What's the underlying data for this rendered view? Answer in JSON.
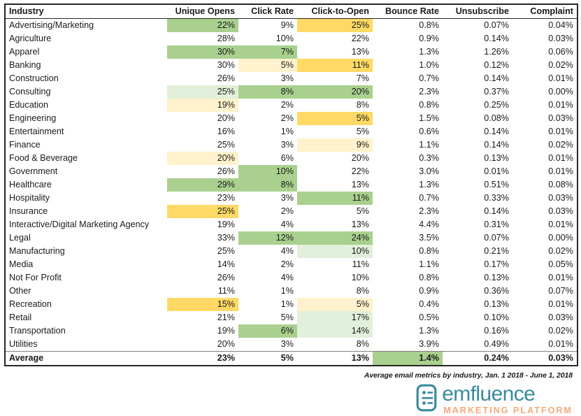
{
  "table": {
    "columns": [
      {
        "key": "industry",
        "label": "Industry",
        "align": "left"
      },
      {
        "key": "unique_opens",
        "label": "Unique Opens",
        "align": "right"
      },
      {
        "key": "click_rate",
        "label": "Click Rate",
        "align": "right"
      },
      {
        "key": "click_to_open",
        "label": "Click-to-Open",
        "align": "right"
      },
      {
        "key": "bounce_rate",
        "label": "Bounce Rate",
        "align": "right"
      },
      {
        "key": "unsubscribe",
        "label": "Unsubscribe",
        "align": "right"
      },
      {
        "key": "complaint",
        "label": "Complaint",
        "align": "right"
      }
    ],
    "rows": [
      {
        "industry": "Advertising/Marketing",
        "unique_opens": "22%",
        "click_rate": "9%",
        "click_to_open": "25%",
        "bounce_rate": "0.8%",
        "unsubscribe": "0.07%",
        "complaint": "0.04%",
        "fills": {
          "unique_opens": "green",
          "click_to_open": "yellow"
        }
      },
      {
        "industry": "Agriculture",
        "unique_opens": "28%",
        "click_rate": "10%",
        "click_to_open": "22%",
        "bounce_rate": "0.9%",
        "unsubscribe": "0.14%",
        "complaint": "0.03%",
        "fills": {}
      },
      {
        "industry": "Apparel",
        "unique_opens": "30%",
        "click_rate": "7%",
        "click_to_open": "13%",
        "bounce_rate": "1.3%",
        "unsubscribe": "1.26%",
        "complaint": "0.06%",
        "fills": {
          "unique_opens": "green",
          "click_rate": "green"
        }
      },
      {
        "industry": "Banking",
        "unique_opens": "30%",
        "click_rate": "5%",
        "click_to_open": "11%",
        "bounce_rate": "1.0%",
        "unsubscribe": "0.12%",
        "complaint": "0.02%",
        "fills": {
          "click_rate": "lyellow",
          "click_to_open": "yellow"
        }
      },
      {
        "industry": "Construction",
        "unique_opens": "26%",
        "click_rate": "3%",
        "click_to_open": "7%",
        "bounce_rate": "0.7%",
        "unsubscribe": "0.14%",
        "complaint": "0.01%",
        "fills": {}
      },
      {
        "industry": "Consulting",
        "unique_opens": "25%",
        "click_rate": "8%",
        "click_to_open": "20%",
        "bounce_rate": "2.3%",
        "unsubscribe": "0.37%",
        "complaint": "0.00%",
        "fills": {
          "unique_opens": "lgreen",
          "click_rate": "green",
          "click_to_open": "green"
        }
      },
      {
        "industry": "Education",
        "unique_opens": "19%",
        "click_rate": "2%",
        "click_to_open": "8%",
        "bounce_rate": "0.8%",
        "unsubscribe": "0.25%",
        "complaint": "0.01%",
        "fills": {
          "unique_opens": "lyellow"
        }
      },
      {
        "industry": "Engineering",
        "unique_opens": "20%",
        "click_rate": "2%",
        "click_to_open": "5%",
        "bounce_rate": "1.5%",
        "unsubscribe": "0.08%",
        "complaint": "0.03%",
        "fills": {
          "click_to_open": "yellow"
        }
      },
      {
        "industry": "Entertainment",
        "unique_opens": "16%",
        "click_rate": "1%",
        "click_to_open": "5%",
        "bounce_rate": "0.6%",
        "unsubscribe": "0.14%",
        "complaint": "0.01%",
        "fills": {}
      },
      {
        "industry": "Finance",
        "unique_opens": "25%",
        "click_rate": "3%",
        "click_to_open": "9%",
        "bounce_rate": "1.1%",
        "unsubscribe": "0.14%",
        "complaint": "0.02%",
        "fills": {
          "click_to_open": "lyellow"
        }
      },
      {
        "industry": "Food & Beverage",
        "unique_opens": "20%",
        "click_rate": "6%",
        "click_to_open": "20%",
        "bounce_rate": "0.3%",
        "unsubscribe": "0.13%",
        "complaint": "0.01%",
        "fills": {
          "unique_opens": "lyellow"
        }
      },
      {
        "industry": "Government",
        "unique_opens": "26%",
        "click_rate": "10%",
        "click_to_open": "22%",
        "bounce_rate": "3.0%",
        "unsubscribe": "0.01%",
        "complaint": "0.01%",
        "fills": {
          "click_rate": "green"
        }
      },
      {
        "industry": "Healthcare",
        "unique_opens": "29%",
        "click_rate": "8%",
        "click_to_open": "13%",
        "bounce_rate": "1.3%",
        "unsubscribe": "0.51%",
        "complaint": "0.08%",
        "fills": {
          "unique_opens": "green",
          "click_rate": "green"
        }
      },
      {
        "industry": "Hospitality",
        "unique_opens": "23%",
        "click_rate": "3%",
        "click_to_open": "11%",
        "bounce_rate": "0.7%",
        "unsubscribe": "0.33%",
        "complaint": "0.03%",
        "fills": {
          "click_to_open": "green"
        }
      },
      {
        "industry": "Insurance",
        "unique_opens": "25%",
        "click_rate": "2%",
        "click_to_open": "5%",
        "bounce_rate": "2.3%",
        "unsubscribe": "0.14%",
        "complaint": "0.03%",
        "fills": {
          "unique_opens": "yellow"
        }
      },
      {
        "industry": "Interactive/Digital Marketing Agency",
        "unique_opens": "19%",
        "click_rate": "4%",
        "click_to_open": "13%",
        "bounce_rate": "4.4%",
        "unsubscribe": "0.31%",
        "complaint": "0.01%",
        "fills": {}
      },
      {
        "industry": "Legal",
        "unique_opens": "33%",
        "click_rate": "12%",
        "click_to_open": "24%",
        "bounce_rate": "3.5%",
        "unsubscribe": "0.07%",
        "complaint": "0.00%",
        "fills": {
          "click_rate": "green",
          "click_to_open": "green"
        }
      },
      {
        "industry": "Manufacturing",
        "unique_opens": "25%",
        "click_rate": "4%",
        "click_to_open": "10%",
        "bounce_rate": "0.8%",
        "unsubscribe": "0.21%",
        "complaint": "0.02%",
        "fills": {
          "click_to_open": "lgreen"
        }
      },
      {
        "industry": "Media",
        "unique_opens": "14%",
        "click_rate": "2%",
        "click_to_open": "11%",
        "bounce_rate": "1.1%",
        "unsubscribe": "0.17%",
        "complaint": "0.05%",
        "fills": {}
      },
      {
        "industry": "Not For Profit",
        "unique_opens": "26%",
        "click_rate": "4%",
        "click_to_open": "10%",
        "bounce_rate": "0.8%",
        "unsubscribe": "0.13%",
        "complaint": "0.01%",
        "fills": {}
      },
      {
        "industry": "Other",
        "unique_opens": "11%",
        "click_rate": "1%",
        "click_to_open": "8%",
        "bounce_rate": "0.9%",
        "unsubscribe": "0.36%",
        "complaint": "0.07%",
        "fills": {}
      },
      {
        "industry": "Recreation",
        "unique_opens": "15%",
        "click_rate": "1%",
        "click_to_open": "5%",
        "bounce_rate": "0.4%",
        "unsubscribe": "0.13%",
        "complaint": "0.01%",
        "fills": {
          "unique_opens": "yellow",
          "click_to_open": "lyellow"
        }
      },
      {
        "industry": "Retail",
        "unique_opens": "21%",
        "click_rate": "5%",
        "click_to_open": "17%",
        "bounce_rate": "0.5%",
        "unsubscribe": "0.10%",
        "complaint": "0.03%",
        "fills": {
          "click_to_open": "lgreen"
        }
      },
      {
        "industry": "Transportation",
        "unique_opens": "19%",
        "click_rate": "6%",
        "click_to_open": "14%",
        "bounce_rate": "1.3%",
        "unsubscribe": "0.16%",
        "complaint": "0.02%",
        "fills": {
          "click_rate": "green",
          "click_to_open": "lgreen"
        }
      },
      {
        "industry": "Utilities",
        "unique_opens": "20%",
        "click_rate": "3%",
        "click_to_open": "8%",
        "bounce_rate": "3.9%",
        "unsubscribe": "0.49%",
        "complaint": "0.01%",
        "fills": {}
      }
    ],
    "average_row": {
      "industry": "Average",
      "unique_opens": "23%",
      "click_rate": "5%",
      "click_to_open": "13%",
      "bounce_rate": "1.4%",
      "unsubscribe": "0.24%",
      "complaint": "0.03%",
      "fills": {
        "bounce_rate": "green"
      }
    }
  },
  "caption": "Average email metrics by industry, Jan. 1 2018 - June 1, 2018",
  "logo": {
    "name": "emfluence",
    "subtitle": "MARKETING PLATFORM",
    "name_color": "#3b8a9e",
    "subtitle_color": "#f5a97a"
  },
  "fill_colors": {
    "green": "#a9d08e",
    "lgreen": "#e2efda",
    "yellow": "#ffd966",
    "lyellow": "#fff2cc"
  }
}
